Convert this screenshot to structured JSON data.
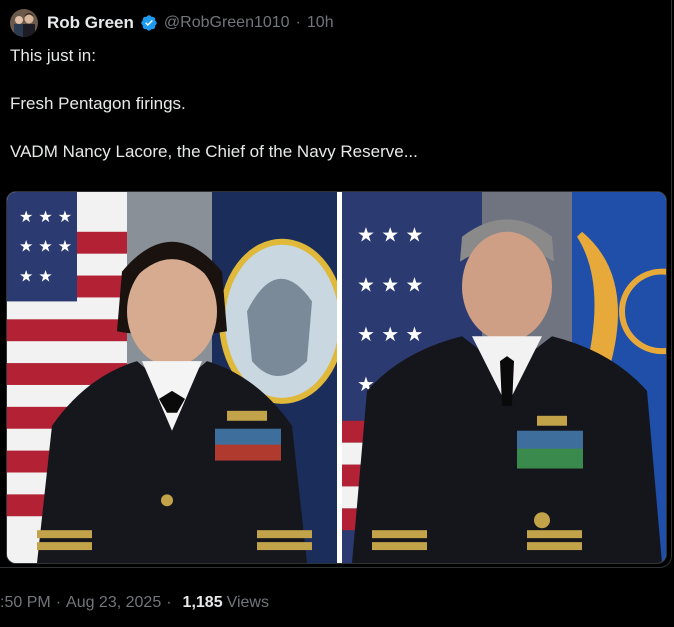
{
  "author": {
    "display_name": "Rob Green",
    "handle": "@RobGreen1010",
    "separator": "·",
    "time_ago": "10h"
  },
  "tweet": {
    "lines": [
      "This just in:",
      "Fresh Pentagon firings.",
      "VADM Nancy Lacore, the Chief of the Navy Reserve..."
    ]
  },
  "footer": {
    "time": ":50 PM",
    "separator": "·",
    "date": "Aug 23, 2025",
    "separator2": "·",
    "views_count": "1,185",
    "views_label": "Views"
  },
  "colors": {
    "background": "#000000",
    "text_primary": "#e7e9ea",
    "text_secondary": "#71767b",
    "verified_badge": "#1d9bf0",
    "border": "#2f3336"
  },
  "icons": {
    "verified": "verified-badge-icon"
  }
}
